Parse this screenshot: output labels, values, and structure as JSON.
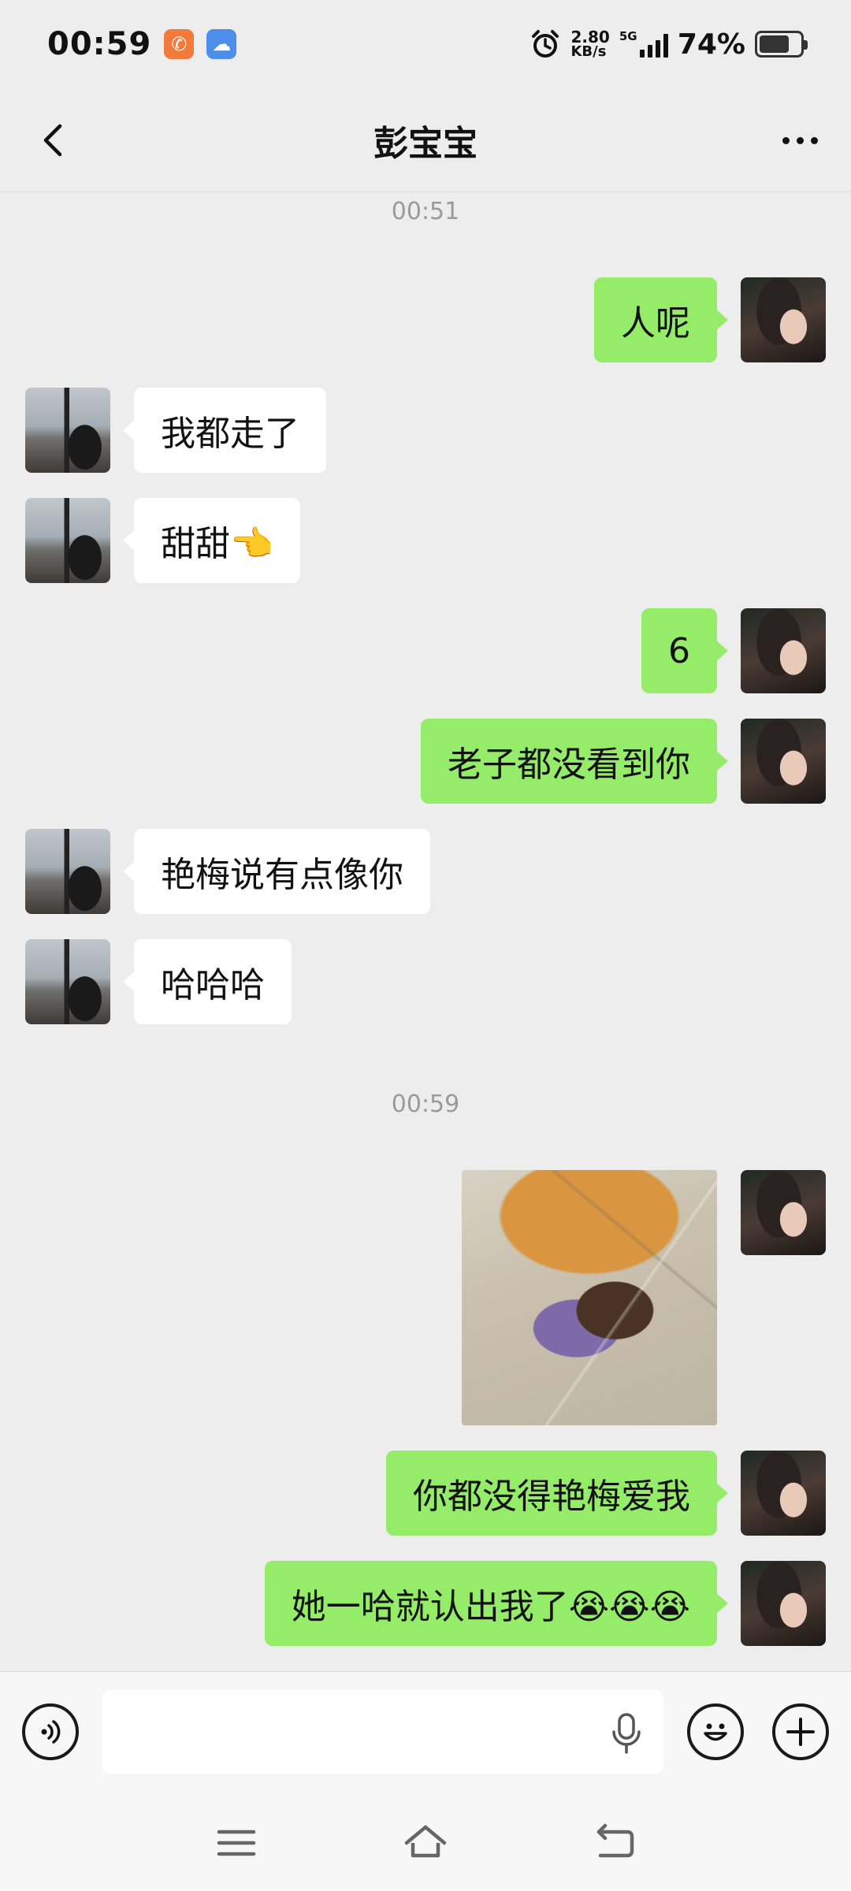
{
  "status_bar": {
    "time": "00:59",
    "net_speed_value": "2.80",
    "net_speed_unit": "KB/s",
    "network": "5G",
    "battery_percent": "74%",
    "battery_level": 0.74
  },
  "header": {
    "title": "彭宝宝"
  },
  "chat": {
    "timestamps": [
      "00:51",
      "00:59"
    ],
    "messages": [
      {
        "from": "me",
        "text": "人呢"
      },
      {
        "from": "other",
        "text": "我都走了"
      },
      {
        "from": "other",
        "text": "甜甜👈"
      },
      {
        "from": "me",
        "text": "6"
      },
      {
        "from": "me",
        "text": "老子都没看到你"
      },
      {
        "from": "other",
        "text": "艳梅说有点像你"
      },
      {
        "from": "other",
        "text": "哈哈哈"
      },
      {
        "from": "me",
        "type": "sticker"
      },
      {
        "from": "me",
        "text": "你都没得艳梅爱我"
      },
      {
        "from": "me",
        "text": "她一哈就认出我了😭😭😭"
      }
    ]
  },
  "input": {
    "value": "",
    "placeholder": ""
  },
  "colors": {
    "my_bubble": "#95ec69",
    "their_bubble": "#ffffff",
    "background": "#ededed"
  }
}
